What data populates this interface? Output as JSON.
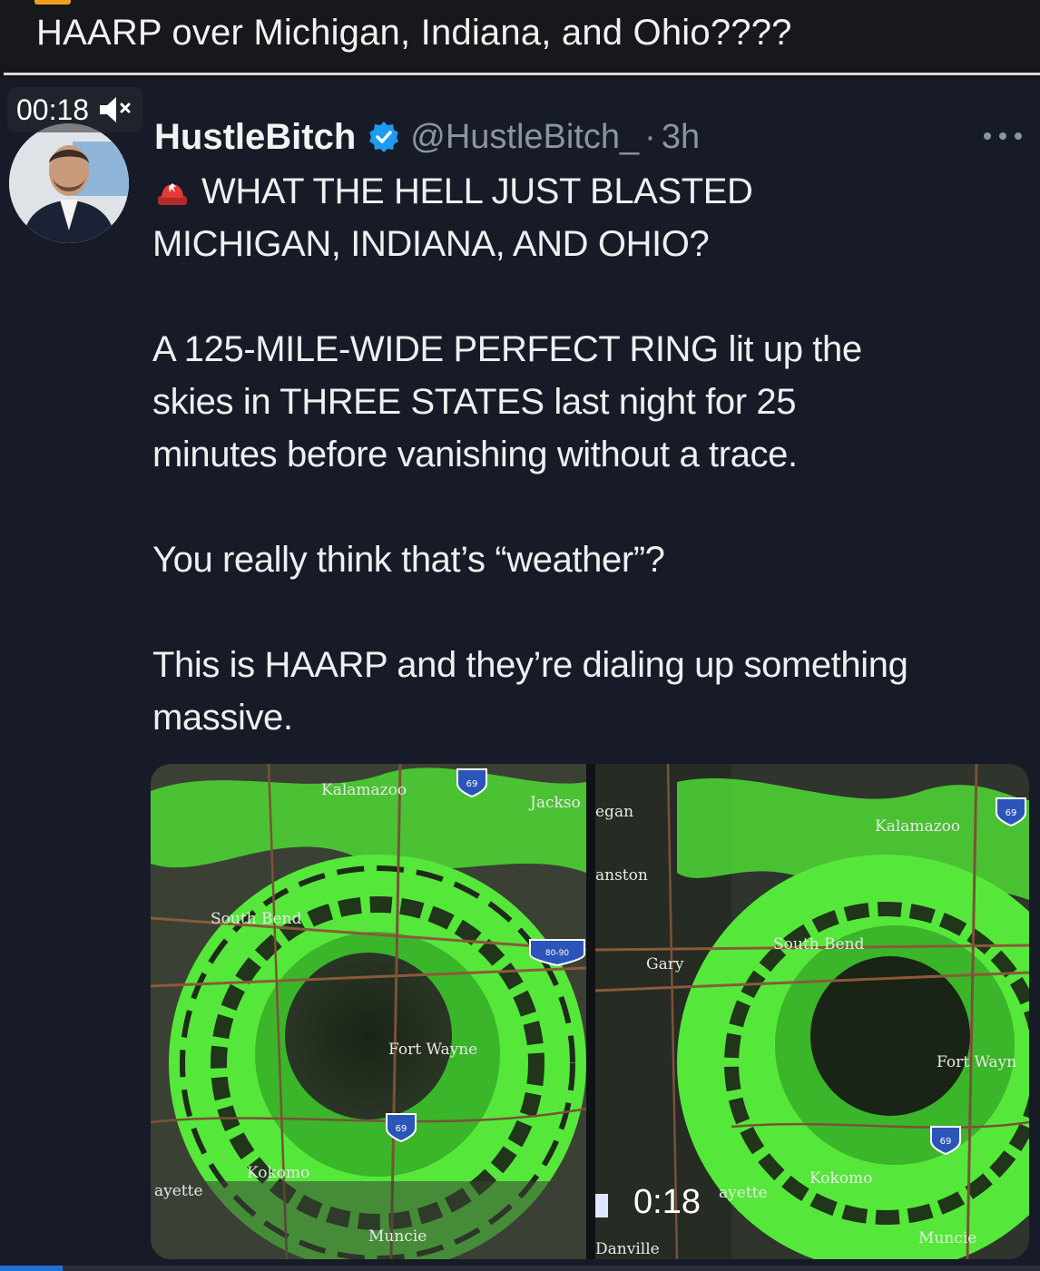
{
  "post": {
    "title": "HAARP over Michigan, Indiana, and Ohio????"
  },
  "video": {
    "timestamp": "00:18",
    "muted": true,
    "inline_timestamp": "0:18",
    "progress_fraction": 0.06
  },
  "tweet": {
    "display_name": "HustleBitch",
    "verified": true,
    "handle": "@HustleBitch_",
    "separator": "·",
    "age": "3h",
    "paragraphs": [
      "WHAT THE HELL JUST BLASTED\nMICHIGAN, INDIANA, AND OHIO?",
      "A 125-MILE-WIDE PERFECT RING lit up the\nskies in THREE STATES last night for 25\nminutes before vanishing without a trace.",
      "You really think that’s “weather”?",
      "This is HAARP and they’re dialing up something\nmassive."
    ]
  },
  "maps": {
    "left": {
      "labels": [
        "Kalamazoo",
        "Jackso",
        "South Bend",
        "Fort Wayne",
        "Kokomo",
        "ayette",
        "Muncie"
      ],
      "shields": [
        "69",
        "80-90",
        "69"
      ]
    },
    "right": {
      "labels": [
        "egan",
        "anston",
        "Gary",
        "Kalamazoo",
        "South Bend",
        "Fort Wayn",
        "Kokomo",
        "ayette",
        "Muncie",
        "Danville"
      ],
      "shields": [
        "69",
        "69"
      ]
    }
  },
  "colors": {
    "background": "#15171d",
    "radar_green": "#5cff3c",
    "verified_blue": "#1d9bf0",
    "accent_orange": "#f0a020"
  }
}
